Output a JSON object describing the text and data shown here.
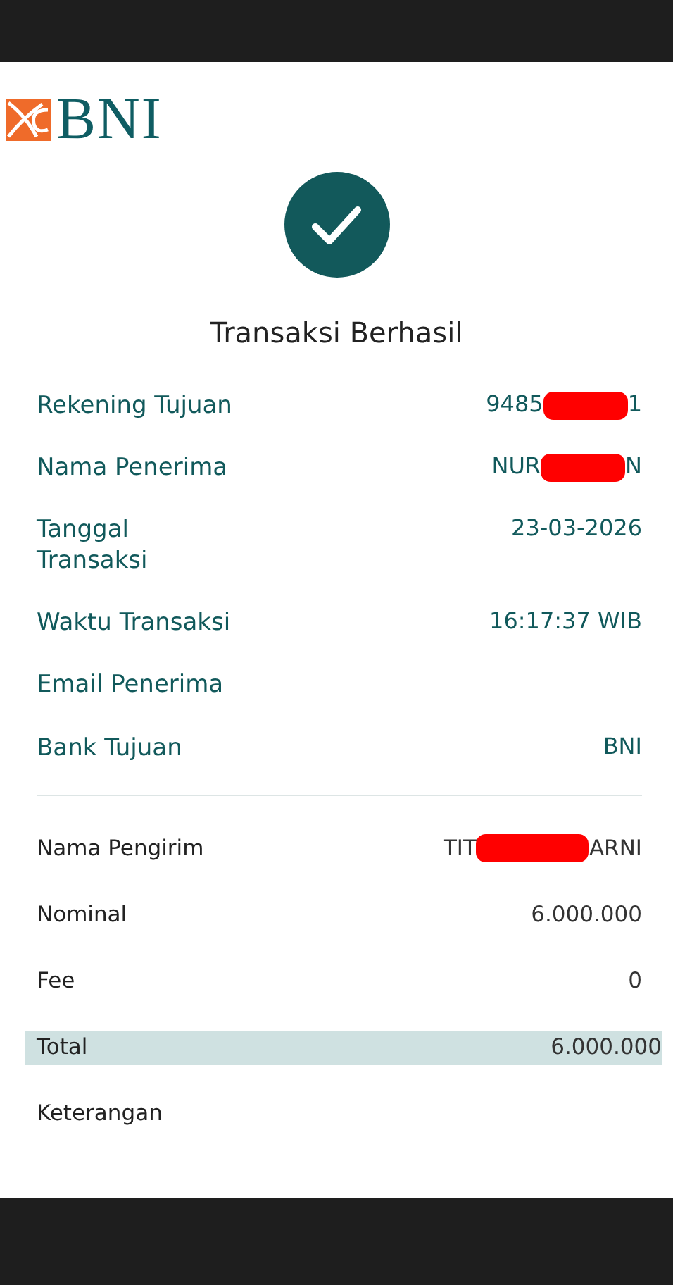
{
  "logo": {
    "text": "BNI"
  },
  "status": {
    "success": true,
    "title": "Transaksi Berhasil"
  },
  "recipient_details": [
    {
      "label": "Rekening Tujuan",
      "value": "9485",
      "value_end": "1",
      "redacted": true
    },
    {
      "label": "Nama Penerima",
      "value": "NUR",
      "value_end": "N",
      "redacted": true
    },
    {
      "label": "Tanggal\nTransaksi",
      "value": "23-03-2026"
    },
    {
      "label": "Waktu Transaksi",
      "value": "16:17:37 WIB"
    },
    {
      "label": "Email Penerima"
    },
    {
      "label": "Bank Tujuan",
      "value": "BNI"
    }
  ],
  "payment_details": [
    {
      "label": "Nama Pengirim",
      "value": "TIT",
      "value_end": "ARNI",
      "redacted": true
    },
    {
      "label": "Nominal",
      "value": "6.000.000"
    },
    {
      "label": "Fee",
      "value": "0"
    },
    {
      "label": "Total",
      "value": "6.000.000",
      "highlighted": true
    },
    {
      "label": "Keterangan"
    }
  ]
}
